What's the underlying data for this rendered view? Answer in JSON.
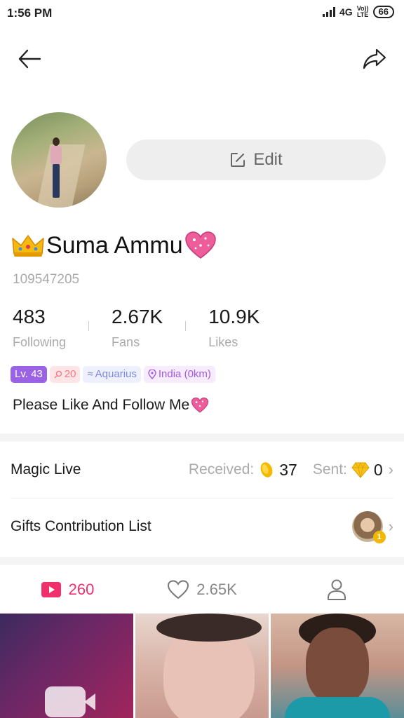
{
  "status_bar": {
    "time": "1:56 PM",
    "network": "4G",
    "volte_top": "Vo))",
    "volte_bottom": "LTE",
    "battery": "66"
  },
  "profile": {
    "edit_label": "Edit",
    "name": "Suma Ammu",
    "id": "109547205",
    "stats": [
      {
        "value": "483",
        "label": "Following"
      },
      {
        "value": "2.67K",
        "label": "Fans"
      },
      {
        "value": "10.9K",
        "label": "Likes"
      }
    ],
    "tags": {
      "level": "Lv. 43",
      "fans": "20",
      "zodiac": "Aquarius",
      "location": "India (0km)"
    },
    "bio": "Please Like And Follow Me"
  },
  "magic_live": {
    "label": "Magic Live",
    "received_label": "Received:",
    "received_value": "37",
    "sent_label": "Sent:",
    "sent_value": "0"
  },
  "gifts": {
    "label": "Gifts Contribution List",
    "badge": "1"
  },
  "tabs": {
    "videos_count": "260",
    "likes_count": "2.65K"
  },
  "colors": {
    "accent": "#f0306a",
    "level_tag": "#9b62e6"
  },
  "icons": [
    "back-arrow-icon",
    "share-icon",
    "edit-icon",
    "crown-icon",
    "heart-emoji-icon",
    "search-icon",
    "aquarius-icon",
    "location-pin-icon",
    "coin-icon",
    "diamond-icon",
    "chevron-right-icon",
    "video-icon",
    "heart-outline-icon",
    "person-icon"
  ]
}
